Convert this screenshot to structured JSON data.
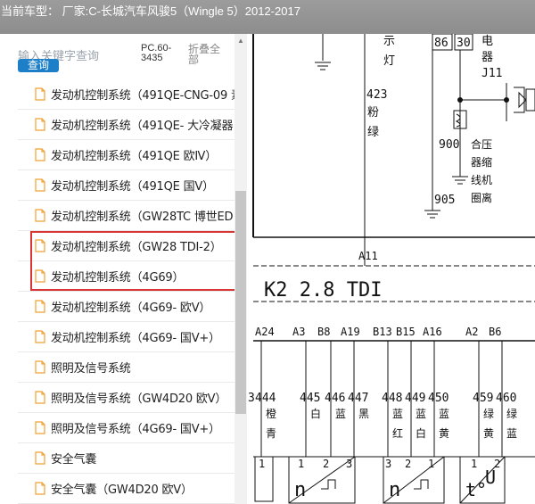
{
  "window": {
    "title": "当前车型：  厂家:C-长城汽车风骏5（Wingle 5）2012-2017"
  },
  "sidebar": {
    "search_placeholder": "输入关键字查询",
    "query_button": "查询",
    "pc_label": "PC.60-3435",
    "collapse_all": "折叠全部",
    "items": [
      {
        "label": "发动机控制系统（491QE-CNG-09 素"
      },
      {
        "label": "发动机控制系统（491QE- 大冷凝器"
      },
      {
        "label": "发动机控制系统（491QE 欧Ⅳ）"
      },
      {
        "label": "发动机控制系统（491QE 国Ⅴ）"
      },
      {
        "label": "发动机控制系统（GW28TC 博世ED"
      },
      {
        "label": "发动机控制系统（GW28 TDI-2）"
      },
      {
        "label": "发动机控制系统（4G69）"
      },
      {
        "label": "发动机控制系统（4G69- 欧Ⅴ）"
      },
      {
        "label": "发动机控制系统（4G69- 国Ⅴ+）"
      },
      {
        "label": "照明及信号系统"
      },
      {
        "label": "照明及信号系统（GW4D20 欧Ⅴ）"
      },
      {
        "label": "照明及信号系统（4G69- 国Ⅴ+）"
      },
      {
        "label": "安全气囊"
      },
      {
        "label": "安全气囊（GW4D20 欧Ⅴ）"
      }
    ],
    "icon": "file-icon",
    "icon_color": "#f0a030",
    "highlight_color": "#d93535"
  },
  "diagram": {
    "top_labels": {
      "lamp": "示\n灯",
      "wire_86": "86",
      "wire_30": "30",
      "relay": "电\n器\nJ11",
      "wire_423": "423",
      "color_pink_green": "粉\n绿",
      "wire_900": "900",
      "compressor": "合压\n器缩\n线机\n圈离",
      "wire_905": "905",
      "connector_a11": "A11"
    },
    "module_title": "K2   2.8 TDI",
    "pins": [
      "A24",
      "A3",
      "B8",
      "A19",
      "B13",
      "B15",
      "A16",
      "A2",
      "B6"
    ],
    "wires": [
      {
        "num": "444",
        "color": "橙\n青"
      },
      {
        "num": "445",
        "color": "白"
      },
      {
        "num": "446",
        "color": "蓝"
      },
      {
        "num": "447",
        "color": "黑"
      },
      {
        "num": "448",
        "color": "蓝\n红"
      },
      {
        "num": "449",
        "color": "蓝\n白"
      },
      {
        "num": "450",
        "color": "蓝\n黄"
      },
      {
        "num": "459",
        "color": "绿\n黄"
      },
      {
        "num": "460",
        "color": "绿\n蓝"
      }
    ],
    "sensor_pins_a": [
      "1",
      "2",
      "3"
    ],
    "sensor_pins_b": [
      "3",
      "2",
      "1"
    ],
    "sensor_pins_c": [
      "1",
      "2"
    ],
    "sensor_symbols": [
      "n",
      "n",
      "t°",
      "U"
    ],
    "left_pin": "3",
    "left_pin_b": "1"
  }
}
